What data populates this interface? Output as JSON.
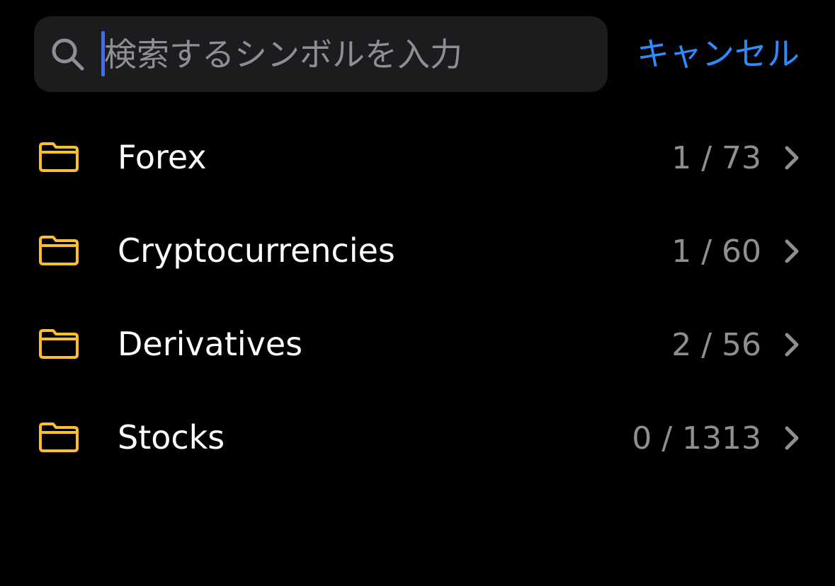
{
  "search": {
    "placeholder": "検索するシンボルを入力",
    "value": "",
    "icon": "search-icon",
    "cancel_label": "キャンセル"
  },
  "colors": {
    "background": "#000000",
    "search_field": "#1c1c1e",
    "accent": "#2f8cff",
    "folder": "#fbbe2d",
    "caret": "#3a6ff7",
    "secondary_text": "#8e8e93"
  },
  "categories": [
    {
      "label": "Forex",
      "count": "1 / 73",
      "icon": "folder-icon"
    },
    {
      "label": "Cryptocurrencies",
      "count": "1 / 60",
      "icon": "folder-icon"
    },
    {
      "label": "Derivatives",
      "count": "2 / 56",
      "icon": "folder-icon"
    },
    {
      "label": "Stocks",
      "count": "0 / 1313",
      "icon": "folder-icon"
    }
  ]
}
